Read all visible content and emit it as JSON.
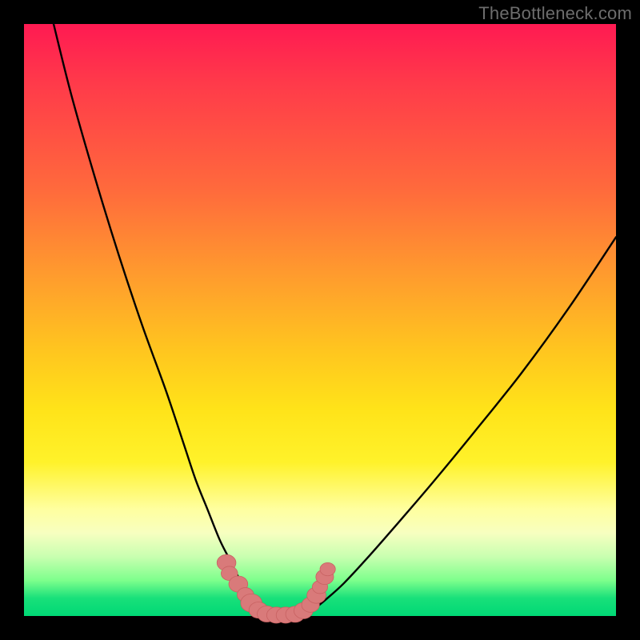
{
  "watermark": "TheBottleneck.com",
  "colors": {
    "frame": "#000000",
    "gradient_top": "#ff1a52",
    "gradient_mid": "#ffe319",
    "gradient_bottom": "#00d875",
    "curve": "#000000",
    "marker_fill": "#d97a7a",
    "marker_stroke": "#c86262"
  },
  "chart_data": {
    "type": "line",
    "title": "",
    "xlabel": "",
    "ylabel": "",
    "xlim": [
      0,
      100
    ],
    "ylim": [
      0,
      100
    ],
    "series": [
      {
        "name": "left-branch",
        "x": [
          5,
          8,
          12,
          16,
          20,
          24,
          27,
          29,
          31,
          33,
          34.5,
          36,
          37.2,
          38.2,
          39,
          39.6,
          40.2
        ],
        "y": [
          100,
          88,
          74,
          61,
          49,
          38,
          29,
          23,
          18,
          13,
          10,
          7,
          4.6,
          2.8,
          1.6,
          0.7,
          0.2
        ]
      },
      {
        "name": "valley-floor",
        "x": [
          40.2,
          41.5,
          43,
          44.5,
          46,
          47.5
        ],
        "y": [
          0.2,
          0.05,
          0.0,
          0.0,
          0.05,
          0.25
        ]
      },
      {
        "name": "right-branch",
        "x": [
          47.5,
          49,
          51,
          54,
          58,
          63,
          69,
          76,
          84,
          92,
          100
        ],
        "y": [
          0.25,
          1.2,
          2.8,
          5.5,
          9.8,
          15.5,
          22.5,
          31,
          41,
          52,
          64
        ]
      }
    ],
    "markers": [
      {
        "x": 34.2,
        "y": 9.0,
        "r": 1.6
      },
      {
        "x": 34.7,
        "y": 7.2,
        "r": 1.4
      },
      {
        "x": 36.2,
        "y": 5.4,
        "r": 1.6
      },
      {
        "x": 37.4,
        "y": 3.6,
        "r": 1.4
      },
      {
        "x": 38.4,
        "y": 2.2,
        "r": 1.8
      },
      {
        "x": 39.6,
        "y": 1.0,
        "r": 1.6
      },
      {
        "x": 41.0,
        "y": 0.35,
        "r": 1.6
      },
      {
        "x": 42.6,
        "y": 0.15,
        "r": 1.6
      },
      {
        "x": 44.2,
        "y": 0.15,
        "r": 1.6
      },
      {
        "x": 45.8,
        "y": 0.3,
        "r": 1.6
      },
      {
        "x": 47.2,
        "y": 0.9,
        "r": 1.6
      },
      {
        "x": 48.4,
        "y": 1.9,
        "r": 1.5
      },
      {
        "x": 49.4,
        "y": 3.5,
        "r": 1.6
      },
      {
        "x": 50.0,
        "y": 4.9,
        "r": 1.3
      },
      {
        "x": 50.8,
        "y": 6.6,
        "r": 1.5
      },
      {
        "x": 51.3,
        "y": 7.9,
        "r": 1.3
      }
    ]
  }
}
